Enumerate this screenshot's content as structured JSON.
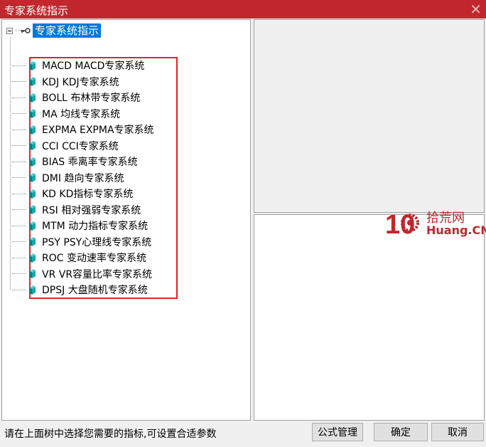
{
  "window": {
    "title": "专家系统指示",
    "close_glyph": "✕"
  },
  "tree": {
    "root_label": "专家系统指示",
    "items": [
      {
        "label": "MACD MACD专家系统"
      },
      {
        "label": "KDJ KDJ专家系统"
      },
      {
        "label": "BOLL 布林带专家系统"
      },
      {
        "label": "MA 均线专家系统"
      },
      {
        "label": "EXPMA EXPMA专家系统"
      },
      {
        "label": "CCI CCI专家系统"
      },
      {
        "label": "BIAS 乖离率专家系统"
      },
      {
        "label": "DMI 趋向专家系统"
      },
      {
        "label": "KD KD指标专家系统"
      },
      {
        "label": "RSI 相对强弱专家系统"
      },
      {
        "label": "MTM 动力指标专家系统"
      },
      {
        "label": "PSY PSY心理线专家系统"
      },
      {
        "label": "ROC 变动速率专家系统"
      },
      {
        "label": "VR VR容量比率专家系统"
      },
      {
        "label": "DPSJ 大盘随机专家系统"
      }
    ]
  },
  "watermark": {
    "cn": "拾荒网",
    "en": "Huang.CN",
    "number": "10"
  },
  "status_text": "请在上面树中选择您需要的指标,可设置合适参数",
  "buttons": {
    "formula": "公式管理",
    "ok": "确定",
    "cancel": "取消"
  },
  "colors": {
    "titlebar": "#c1272d",
    "selection": "#0078d7",
    "highlight_box": "#e02424",
    "book_icon": "#1aa6a6"
  }
}
